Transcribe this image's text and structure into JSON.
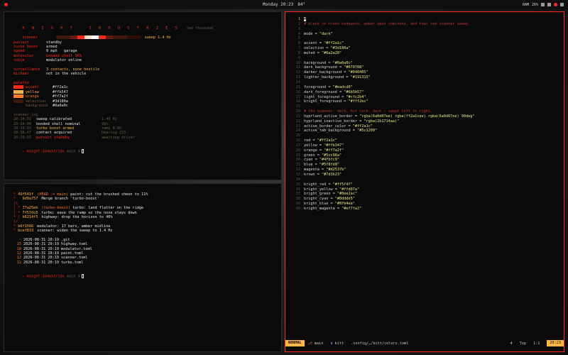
{
  "topbar": {
    "clock": "Monday 20:23",
    "weather": "84°",
    "status": [
      "RAM",
      "26%"
    ],
    "workspace_label": "1"
  },
  "w1": {
    "title": "K N I G H T   I N D U S T R I E S",
    "subtitle": "two thousand",
    "scanner_label": "scanner",
    "scanner_value": "sweep 1.4 Hz",
    "scanner_colors": [
      "#3d180a",
      "#3d180a",
      "#6a1a12",
      "#ff2a1c",
      "#ffe0d0",
      "#ffffff",
      "#ff2a1c",
      "#6a1a12",
      "#3d180a",
      "#3d180a",
      "#2a0e08",
      "#2a0e08"
    ],
    "status": [
      {
        "k": "pursuit",
        "v": "standby",
        "c": "white"
      },
      {
        "k": "turbo boost",
        "v": "armed",
        "c": "white"
      },
      {
        "k": "speed",
        "v": "0 mph   garage",
        "c": "white"
      },
      {
        "k": "molecular",
        "v": "bonded shell 96%",
        "c": "red"
      },
      {
        "k": "voice",
        "v": "modulator online",
        "c": "white"
      }
    ],
    "surveillance": [
      {
        "k": "surveillance",
        "v": "3 contacts, none hostile",
        "c": "yellow"
      },
      {
        "k": "michael",
        "v": "not in the vehicle",
        "c": "white"
      }
    ],
    "palette_label": "palette",
    "palette": [
      {
        "name": "accent",
        "hex": "#ff2a1c",
        "color": "#ff2a1c"
      },
      {
        "name": "yellow",
        "hex": "#ffb547",
        "color": "#ffb547"
      },
      {
        "name": "orange",
        "hex": "#ff7a2f",
        "color": "#ff7a2f"
      },
      {
        "name": "selection",
        "hex": "#3d180a",
        "color": "#3d180a"
      },
      {
        "name": "background",
        "hex": "#0a0a0c",
        "color": "#0a0a0c"
      }
    ],
    "log_label": "scanner log",
    "log": [
      {
        "t": "20:14:01",
        "m": "sweep calibrated",
        "d": "1.40 Hz",
        "mc": "white"
      },
      {
        "t": "20:14:09",
        "m": "bonded shell nominal",
        "d": "96%",
        "mc": "white"
      },
      {
        "t": "20:16:33",
        "m": "turbo boost armed",
        "d": "ramp 0.65",
        "mc": "yellow"
      },
      {
        "t": "20:18:47",
        "m": "contact acquired",
        "d": "bearing 215",
        "mc": "white"
      },
      {
        "t": "20:19:55",
        "m": "pursuit standby",
        "d": "awaiting driver",
        "mc": "red"
      }
    ],
    "prompt": "knight-industries",
    "prompt_dir": "main $"
  },
  "w2": {
    "git": [
      {
        "g": "* ",
        "h": "49f541f",
        "r": "(HEAD -> main)",
        "m": " paint: cut the brushed sheen to 11%"
      },
      {
        "g": "*   ",
        "h": "9d9a757",
        "r": "",
        "m": " Merge branch 'turbo-boost'"
      },
      {
        "g": "|\\",
        "h": "",
        "r": "",
        "m": ""
      },
      {
        "g": "| * ",
        "h": "77a25eb",
        "r": "(turbo-boost)",
        "m": " turbo: land flatter on the ridge"
      },
      {
        "g": "| * ",
        "h": "7f57dc0",
        "r": "",
        "m": " turbo: ease the ramp so the nose stays down"
      },
      {
        "g": "* | ",
        "h": "b6214f5",
        "r": "",
        "m": " highway: drop the horizon to 46%"
      },
      {
        "g": "|/",
        "h": "",
        "r": "",
        "m": ""
      },
      {
        "g": "* ",
        "h": "b6f1566",
        "r": "",
        "m": " modulator: 17 bars, amber midline"
      },
      {
        "g": "* ",
        "h": "bcef833",
        "r": "",
        "m": " scanner: widen the sweep to 1.4 Hz"
      }
    ],
    "files": [
      {
        "s": "-",
        "d": "2026-08-31 20:19",
        "n": ".git"
      },
      {
        "s": "15",
        "d": "2026-08-31 20:19",
        "n": "highway.toml"
      },
      {
        "s": "10",
        "d": "2026-08-31 20:19",
        "n": "modulator.toml"
      },
      {
        "s": "12",
        "d": "2026-08-31 20:19",
        "n": "paint.toml"
      },
      {
        "s": "12",
        "d": "2026-08-31 20:19",
        "n": "scanner.toml"
      },
      {
        "s": "12",
        "d": "2026-08-31 20:19",
        "n": "turbo.toml"
      }
    ],
    "prompt": "knight-industries",
    "prompt_dir": "main $"
  },
  "editor": {
    "lines": [
      {
        "n": "1",
        "parts": [
          [
            "cursor",
            "#"
          ]
        ]
      },
      {
        "n": "2",
        "parts": [
          [
            "cmt",
            "# black ce trans bodywork, amber dash chevrons, and that red scanner sweep."
          ]
        ]
      },
      {
        "n": "3",
        "parts": []
      },
      {
        "n": "4",
        "parts": [
          [
            "k2",
            "mode = "
          ],
          [
            "str",
            "\"dark\""
          ]
        ]
      },
      {
        "n": "5",
        "parts": []
      },
      {
        "n": "6",
        "parts": [
          [
            "k2",
            "accent = "
          ],
          [
            "str",
            "\"#ff2a1c\""
          ]
        ]
      },
      {
        "n": "7",
        "parts": [
          [
            "k2",
            "selection = "
          ],
          [
            "str",
            "\"#3d180a\""
          ]
        ]
      },
      {
        "n": "8",
        "parts": [
          [
            "k2",
            "muted = "
          ],
          [
            "str",
            "\"#6a2a20\""
          ]
        ]
      },
      {
        "n": "9",
        "parts": []
      },
      {
        "n": "10",
        "parts": [
          [
            "k2",
            "background = "
          ],
          [
            "str",
            "\"#0a0a0c\""
          ]
        ]
      },
      {
        "n": "11",
        "parts": [
          [
            "k2",
            "dark_background = "
          ],
          [
            "str",
            "\"#070708\""
          ]
        ]
      },
      {
        "n": "12",
        "parts": [
          [
            "k2",
            "darker_background = "
          ],
          [
            "str",
            "\"#040405\""
          ]
        ]
      },
      {
        "n": "13",
        "parts": [
          [
            "k2",
            "lighter_background = "
          ],
          [
            "str",
            "\"#191315\""
          ]
        ]
      },
      {
        "n": "14",
        "parts": []
      },
      {
        "n": "15",
        "parts": [
          [
            "k2",
            "foreground = "
          ],
          [
            "str",
            "\"#eadcd0\""
          ]
        ]
      },
      {
        "n": "16",
        "parts": [
          [
            "k2",
            "dark_foreground = "
          ],
          [
            "str",
            "\"#6b5b57\""
          ]
        ]
      },
      {
        "n": "17",
        "parts": [
          [
            "k2",
            "light_foreground = "
          ],
          [
            "str",
            "\"#cfc2b4\""
          ]
        ]
      },
      {
        "n": "18",
        "parts": [
          [
            "k2",
            "bright_foreground = "
          ],
          [
            "str",
            "\"#fff2ec\""
          ]
        ]
      },
      {
        "n": "19",
        "parts": []
      },
      {
        "n": "20",
        "parts": [
          [
            "cmt",
            "# the scanner: dark, hot core, dark — swept left to right."
          ]
        ]
      },
      {
        "n": "21",
        "parts": [
          [
            "k2",
            "hyprland_active_border = "
          ],
          [
            "str",
            "\"rgba(6a0d07ee) rgba(ff2a1cee) rgba(6a0d07ee) 90deg\""
          ]
        ]
      },
      {
        "n": "22",
        "parts": [
          [
            "k2",
            "hyprland_inactive_border = "
          ],
          [
            "str",
            "\"rgba(2b1714aa)\""
          ]
        ]
      },
      {
        "n": "23",
        "parts": [
          [
            "k2",
            "active_border_color = "
          ],
          [
            "str",
            "\"#ff2a1c\""
          ]
        ]
      },
      {
        "n": "24",
        "parts": [
          [
            "k2",
            "active_tab_background = "
          ],
          [
            "str",
            "\"#5c1209\""
          ]
        ]
      },
      {
        "n": "25",
        "parts": []
      },
      {
        "n": "26",
        "parts": [
          [
            "k2",
            "red = "
          ],
          [
            "str",
            "\"#ff2a1c\""
          ]
        ]
      },
      {
        "n": "27",
        "parts": [
          [
            "k2",
            "yellow = "
          ],
          [
            "str",
            "\"#ffb347\""
          ]
        ]
      },
      {
        "n": "28",
        "parts": [
          [
            "k2",
            "orange = "
          ],
          [
            "str",
            "\"#ff7a2f\""
          ]
        ]
      },
      {
        "n": "29",
        "parts": [
          [
            "k2",
            "green = "
          ],
          [
            "str",
            "\"#5cc98a\""
          ]
        ]
      },
      {
        "n": "30",
        "parts": [
          [
            "k2",
            "cyan = "
          ],
          [
            "str",
            "\"#4fbfc9\""
          ]
        ]
      },
      {
        "n": "31",
        "parts": [
          [
            "k2",
            "blue = "
          ],
          [
            "str",
            "\"#5f8fd0\""
          ]
        ]
      },
      {
        "n": "32",
        "parts": [
          [
            "k2",
            "magenta = "
          ],
          [
            "str",
            "\"#d2537b\""
          ]
        ]
      },
      {
        "n": "33",
        "parts": [
          [
            "k2",
            "brown = "
          ],
          [
            "str",
            "\"#7d3b23\""
          ]
        ]
      },
      {
        "n": "34",
        "parts": []
      },
      {
        "n": "35",
        "parts": [
          [
            "k2",
            "bright_red = "
          ],
          [
            "str",
            "\"#ff5f4f\""
          ]
        ]
      },
      {
        "n": "36",
        "parts": [
          [
            "k2",
            "bright_yellow = "
          ],
          [
            "str",
            "\"#ffd07a\""
          ]
        ]
      },
      {
        "n": "37",
        "parts": [
          [
            "k2",
            "bright_green = "
          ],
          [
            "str",
            "\"#8ee2ac\""
          ]
        ]
      },
      {
        "n": "38",
        "parts": [
          [
            "k2",
            "bright_cyan = "
          ],
          [
            "str",
            "\"#8ddde5\""
          ]
        ]
      },
      {
        "n": "39",
        "parts": [
          [
            "k2",
            "bright_blue = "
          ],
          [
            "str",
            "\"#8fb4ea\""
          ]
        ]
      },
      {
        "n": "40",
        "parts": [
          [
            "k2",
            "bright_magenta = "
          ],
          [
            "str",
            "\"#ef7fa2\""
          ]
        ]
      }
    ],
    "status": {
      "mode": "NORMAL",
      "branch": "main",
      "app": "kitt",
      "file": ".config/…/kitt/colors.toml",
      "col": "4",
      "pos": "Top",
      "loc": "1:1",
      "time": "20:23"
    }
  }
}
